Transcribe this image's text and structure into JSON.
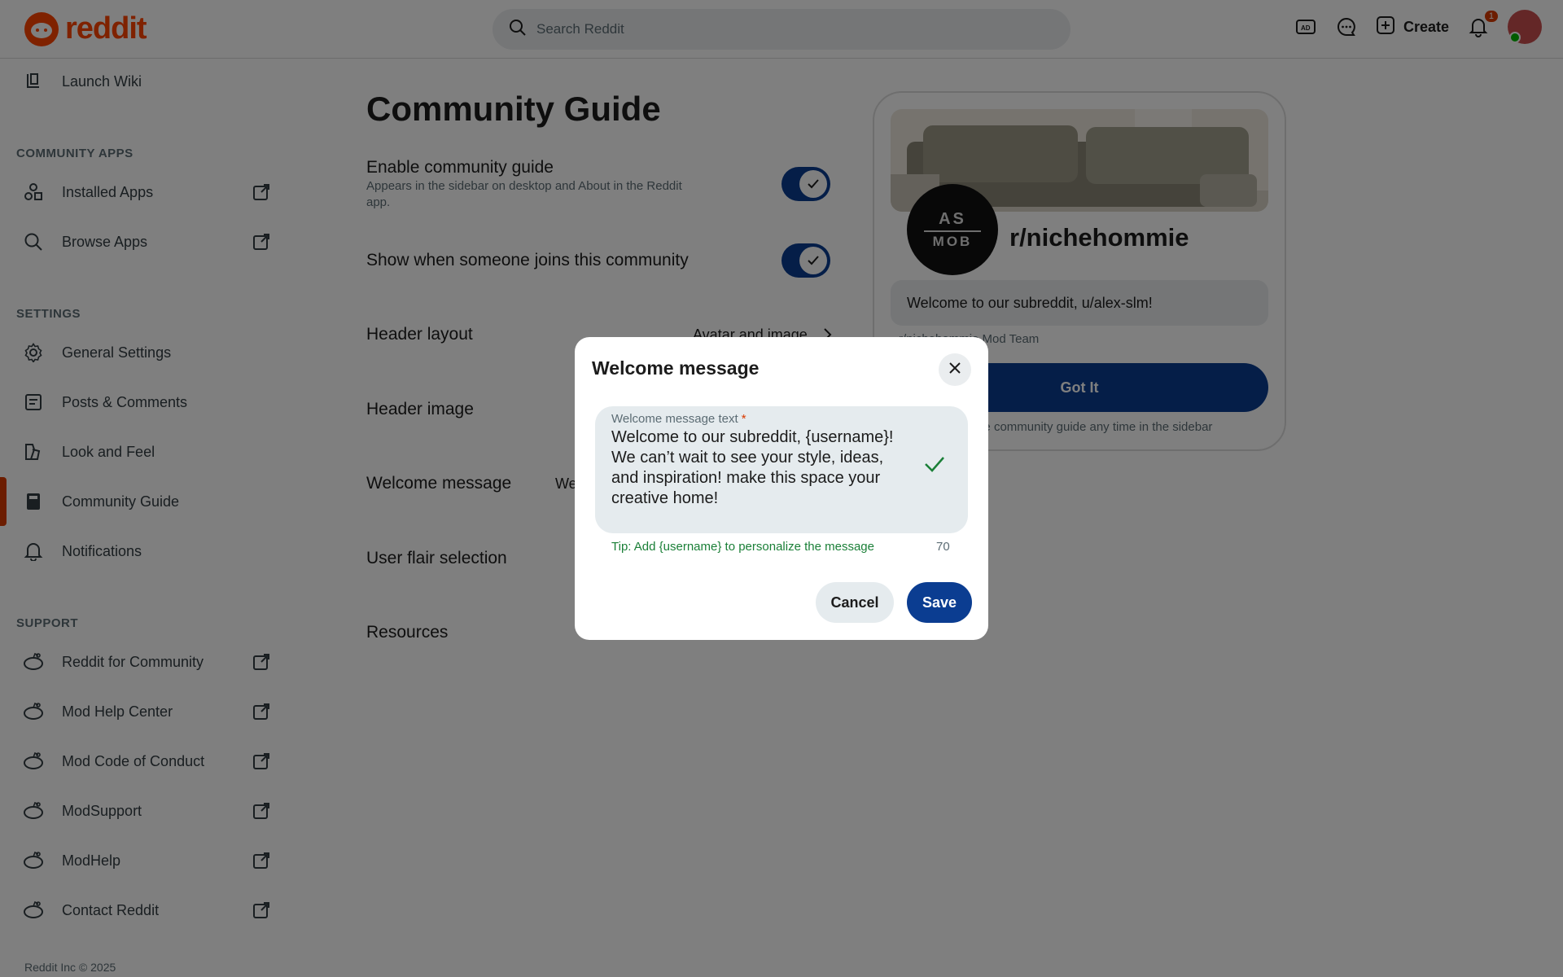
{
  "header": {
    "logo_text": "reddit",
    "search_placeholder": "Search Reddit",
    "create_label": "Create",
    "notification_count": "1"
  },
  "sidebar": {
    "launch_wiki": "Launch Wiki",
    "community_apps_heading": "COMMUNITY APPS",
    "apps": [
      {
        "label": "Installed Apps",
        "icon": "shapes-icon"
      },
      {
        "label": "Browse Apps",
        "icon": "search-icon"
      }
    ],
    "settings_heading": "SETTINGS",
    "settings": [
      {
        "label": "General Settings",
        "icon": "gear-icon"
      },
      {
        "label": "Posts & Comments",
        "icon": "post-icon"
      },
      {
        "label": "Look and Feel",
        "icon": "brush-icon"
      },
      {
        "label": "Community Guide",
        "icon": "book-icon",
        "active": true
      },
      {
        "label": "Notifications",
        "icon": "bell-icon"
      }
    ],
    "support_heading": "SUPPORT",
    "support": [
      {
        "label": "Reddit for Community"
      },
      {
        "label": "Mod Help Center"
      },
      {
        "label": "Mod Code of Conduct"
      },
      {
        "label": "ModSupport"
      },
      {
        "label": "ModHelp"
      },
      {
        "label": "Contact Reddit"
      }
    ],
    "footer": "Reddit Inc © 2025"
  },
  "main": {
    "title": "Community Guide",
    "enable_guide_label": "Enable community guide",
    "enable_guide_desc": "Appears in the sidebar on desktop and About in the Reddit app.",
    "enable_guide_on": true,
    "show_join_label": "Show when someone joins this community",
    "show_join_on": true,
    "header_layout_label": "Header layout",
    "header_layout_value": "Avatar and image",
    "header_image_label": "Header image",
    "welcome_message_label": "Welcome message",
    "welcome_message_value_partial": "We",
    "user_flair_label": "User flair selection",
    "resources_label": "Resources"
  },
  "preview": {
    "avatar_text_top": "AS",
    "avatar_text_bottom": "MOB",
    "community_name": "r/nichehommie",
    "welcome_text": "Welcome to our subreddit, u/alex-slm!",
    "mod_team": "r/nichehommie Mod Team",
    "got_it": "Got It",
    "find_text": "Find the community guide any time in the sidebar"
  },
  "modal": {
    "title": "Welcome message",
    "field_label": "Welcome message text",
    "required_mark": "*",
    "field_value": "Welcome to our subreddit, {username}! We can’t wait to see your style, ideas, and inspiration! make this space your creative home!",
    "tip": "Tip: Add {username} to personalize the message",
    "char_count": "70",
    "cancel_label": "Cancel",
    "save_label": "Save"
  },
  "colors": {
    "brand": "#ff4500",
    "primary_button": "#0b3d91",
    "active_indicator": "#d93a00",
    "tip_green": "#1a7f37"
  }
}
